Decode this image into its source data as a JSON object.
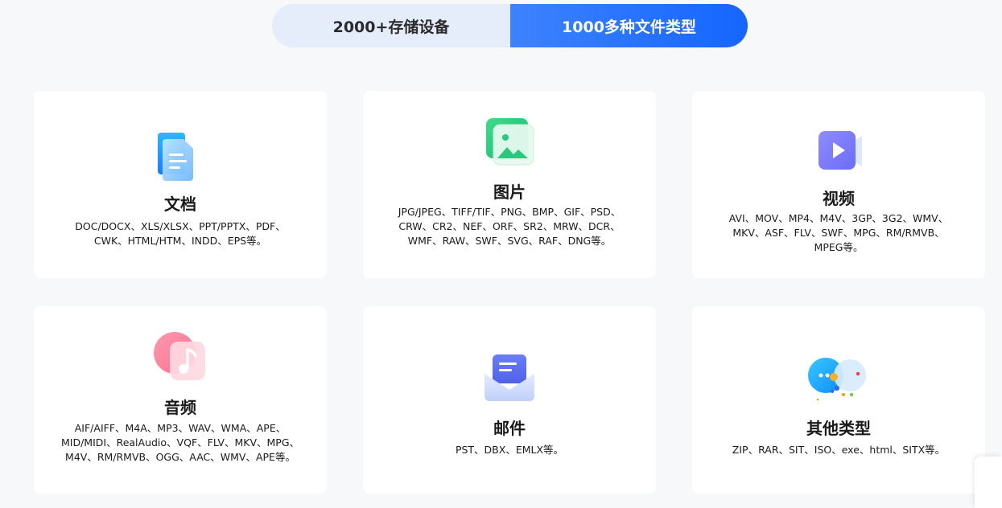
{
  "tabs": [
    {
      "label": "2000+存储设备",
      "active": false
    },
    {
      "label": "1000多种文件类型",
      "active": true
    }
  ],
  "cards": [
    {
      "title": "文档",
      "icon": "document-icon",
      "desc": "DOC/DOCX、XLS/XLSX、PPT/PPTX、PDF、CWK、HTML/HTM、INDD、EPS等。"
    },
    {
      "title": "图片",
      "icon": "image-icon",
      "desc": "JPG/JPEG、TIFF/TIF、PNG、BMP、GIF、PSD、CRW、CR2、NEF、ORF、SR2、MRW、DCR、WMF、RAW、SWF、SVG、RAF、DNG等。"
    },
    {
      "title": "视频",
      "icon": "video-icon",
      "desc": "AVI、MOV、MP4、M4V、3GP、3G2、WMV、MKV、ASF、FLV、SWF、MPG、RM/RMVB、MPEG等。"
    },
    {
      "title": "音频",
      "icon": "music-icon",
      "desc": "AIF/AIFF、M4A、MP3、WAV、WMA、APE、MID/MIDI、RealAudio、VQF、FLV、MKV、MPG、M4V、RM/RMVB、OGG、AAC、WMV、APE等。"
    },
    {
      "title": "邮件",
      "icon": "mail-icon",
      "desc": "PST、DBX、EMLX等。"
    },
    {
      "title": "其他类型",
      "icon": "chat-bubbles-icon",
      "desc": "ZIP、RAR、SIT、ISO、exe、html、SITX等。"
    }
  ],
  "colors": {
    "accent": "#1565ff",
    "tab_inactive_bg": "#e6edfa",
    "page_bg": "#f7f8fa"
  }
}
